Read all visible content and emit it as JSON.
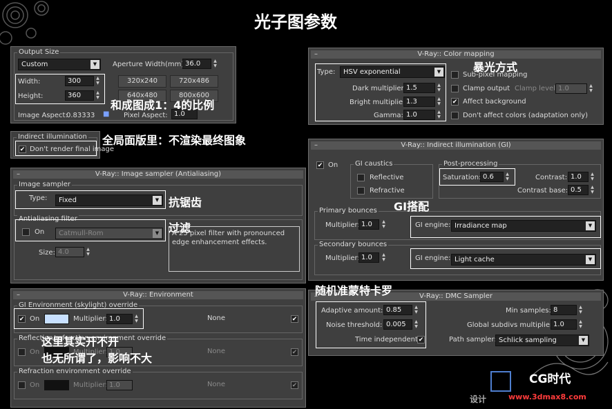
{
  "header": {
    "title": "光子图参数"
  },
  "annotations": {
    "exposure": "暴光方式",
    "ratio": "和成图成1：4的比例",
    "global_switch": "全局面版里：不渲染最终图象",
    "antialias": "抗锯齿",
    "filter": "过滤",
    "gi": "GI搭配",
    "dmc": "随机准蒙特卡罗",
    "env_line1": "这里其实开不开",
    "env_line2": "也无所谓了，影响不大"
  },
  "output_size": {
    "group_label": "Output Size",
    "preset": "Custom",
    "aperture_label": "Aperture Width(mm):",
    "aperture_value": "36.0",
    "width_label": "Width:",
    "width_value": "300",
    "height_label": "Height:",
    "height_value": "360",
    "presets": [
      "320x240",
      "720x486",
      "640x480",
      "800x600"
    ],
    "image_aspect_label": "Image Aspect:",
    "image_aspect_value": "0.83333",
    "pixel_aspect_label": "Pixel Aspect:",
    "pixel_aspect_value": "1.0"
  },
  "indirect_illum": {
    "group_label": "Indirect illumination",
    "dont_render_label": "Don't render final image",
    "dont_render_checked": "✔"
  },
  "image_sampler": {
    "title": "V-Ray:: Image sampler (Antialiasing)",
    "group_label": "Image sampler",
    "type_label": "Type:",
    "type_value": "Fixed",
    "aa_group_label": "Antialiasing filter",
    "on_label": "On",
    "filter_value": "Catmull-Rom",
    "description": "A 25 pixel filter with pronounced edge enhancement effects.",
    "size_label": "Size:",
    "size_value": "4.0"
  },
  "environment": {
    "title": "V-Ray:: Environment",
    "gi_group": "GI Environment (skylight) override",
    "on_label": "On",
    "on_checked": "✔",
    "multiplier_label": "Multiplier:",
    "multiplier_value": "1.0",
    "none_label": "None",
    "refl_group": "Reflection/refraction environment override",
    "refl_multiplier": "1.0",
    "refr_group": "Refraction environment override",
    "refr_multiplier": "1.0",
    "swatch_color": "#c8e0ff"
  },
  "color_mapping": {
    "title": "V-Ray:: Color mapping",
    "type_label": "Type:",
    "type_value": "HSV exponential",
    "dark_label": "Dark multiplier:",
    "dark_value": "1.5",
    "bright_label": "Bright multiplier:",
    "bright_value": "1.3",
    "gamma_label": "Gamma:",
    "gamma_value": "1.0",
    "subpixel_label": "Sub-pixel mapping",
    "clamp_label": "Clamp output",
    "clamp_level_label": "Clamp level:",
    "clamp_level_value": "1.0",
    "affect_bg_label": "Affect background",
    "affect_bg_checked": "✔",
    "dont_affect_label": "Don't affect colors (adaptation only)"
  },
  "gi": {
    "title": "V-Ray:: Indirect illumination (GI)",
    "on_label": "On",
    "on_checked": "✔",
    "caustics_group": "GI caustics",
    "reflective_label": "Reflective",
    "refractive_label": "Refractive",
    "post_group": "Post-processing",
    "saturation_label": "Saturation:",
    "saturation_value": "0.6",
    "contrast_label": "Contrast:",
    "contrast_value": "1.0",
    "contrast_base_label": "Contrast base:",
    "contrast_base_value": "0.5",
    "primary_group": "Primary bounces",
    "primary_multiplier_label": "Multiplier:",
    "primary_multiplier_value": "1.0",
    "primary_engine_label": "GI engine:",
    "primary_engine_value": "Irradiance map",
    "secondary_group": "Secondary bounces",
    "secondary_multiplier_label": "Multiplier:",
    "secondary_multiplier_value": "1.0",
    "secondary_engine_label": "GI engine:",
    "secondary_engine_value": "Light cache"
  },
  "dmc": {
    "title": "V-Ray:: DMC Sampler",
    "adaptive_label": "Adaptive amount:",
    "adaptive_value": "0.85",
    "noise_label": "Noise threshold:",
    "noise_value": "0.005",
    "time_label": "Time independent",
    "time_checked": "✔",
    "min_samples_label": "Min samples:",
    "min_samples_value": "8",
    "subdivs_label": "Global subdivs multiplier:",
    "subdivs_value": "1.0",
    "path_label": "Path sampler:",
    "path_value": "Schlick sampling"
  },
  "watermark": {
    "brand": "CG时代",
    "url": "www.3dmax8.com",
    "side_text": "设计"
  }
}
